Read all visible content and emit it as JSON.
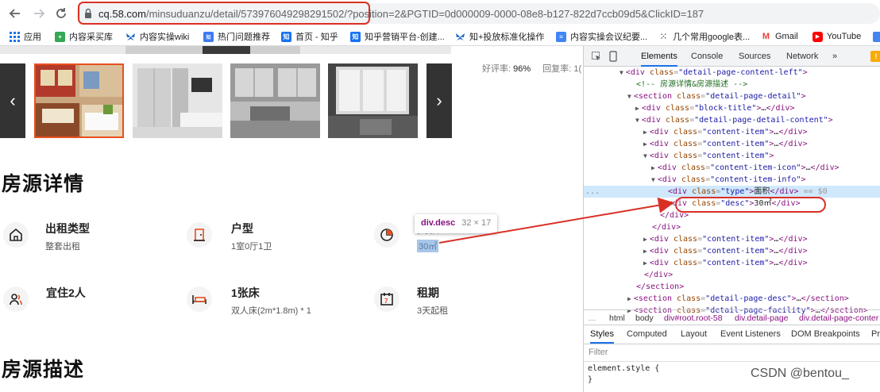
{
  "browser": {
    "url_host": "cq.58.com",
    "url_path": "/minsuduanzu/detail/57397604929829150​2/?position=2&PGTID=0d000009-0000-08e8-b127-822d7ccb09d5&ClickID=187",
    "url_path_clean": "/minsuduanzu/detail/573976049298291502/?position=2&PGTID=0d000009-0000-08e8-b127-822d7ccb09d5&ClickID=187"
  },
  "bookmarks": [
    {
      "label": "应用",
      "icon": "apps-grid-icon",
      "color": "#1a73e8"
    },
    {
      "label": "内容采买库",
      "icon": "plus-square-icon",
      "color": "#34a853"
    },
    {
      "label": "内容实操wiki",
      "icon": "butterfly-icon",
      "color": "#1565c0"
    },
    {
      "label": "热门问题推荐",
      "icon": "zhihu-bubble-icon",
      "color": "#3d7bf6"
    },
    {
      "label": "首页 - 知乎",
      "icon": "zhihu-icon",
      "color": "#1772f6"
    },
    {
      "label": "知乎营销平台-创建...",
      "icon": "zhihu-icon",
      "color": "#1772f6"
    },
    {
      "label": "知+投放标准化操作",
      "icon": "butterfly-icon",
      "color": "#1565c0"
    },
    {
      "label": "内容实操会议纪要...",
      "icon": "doc-icon",
      "color": "#4285f4"
    },
    {
      "label": "几个常用google表...",
      "icon": "dots-grid-icon",
      "color": "#5f6368"
    },
    {
      "label": "Gmail",
      "icon": "gmail-icon",
      "color": "#ea4335"
    },
    {
      "label": "YouTube",
      "icon": "youtube-icon",
      "color": "#ff0000"
    }
  ],
  "gallery": {
    "prev_label": "‹",
    "next_label": "›"
  },
  "rating": {
    "good_label": "好评率:",
    "good_value": "96%",
    "reply_label": "回复率:",
    "reply_value": "1("
  },
  "sections": {
    "detail_title": "房源详情",
    "desc_title": "房源描述"
  },
  "items": [
    {
      "type": "出租类型",
      "desc": "整套出租",
      "icon": "house-icon"
    },
    {
      "type": "户型",
      "desc": "1室0厅1卫",
      "icon": "door-icon"
    },
    {
      "type": "面积",
      "desc": "30㎡",
      "icon": "pie-icon"
    },
    {
      "type": "宜住2人",
      "desc": "",
      "icon": "people-icon"
    },
    {
      "type": "1张床",
      "desc": "双人床(2m*1.8m) * 1",
      "icon": "bed-icon"
    },
    {
      "type": "租期",
      "desc": "3天起租",
      "icon": "calendar-icon"
    }
  ],
  "tooltip": {
    "selector": "div.desc",
    "size": "32 × 17"
  },
  "devtools": {
    "tabs": [
      "Elements",
      "Console",
      "Sources",
      "Network",
      "»"
    ],
    "warn_count": "!",
    "dom_lines": [
      {
        "indent": 0,
        "tri": "▼",
        "html": "<div class=\"detail-page-content-left\">"
      },
      {
        "indent": 1,
        "tri": "",
        "comment": "<!-- 房源详情&房源描述 -->"
      },
      {
        "indent": 1,
        "tri": "▼",
        "html": "<section class=\"detail-page-detail\">"
      },
      {
        "indent": 2,
        "tri": "▶",
        "html": "<div class=\"block-title\">…</div>"
      },
      {
        "indent": 2,
        "tri": "▼",
        "html": "<div class=\"detail-page-detail-content\">"
      },
      {
        "indent": 3,
        "tri": "▶",
        "html": "<div class=\"content-item\">…</div>"
      },
      {
        "indent": 3,
        "tri": "▶",
        "html": "<div class=\"content-item\">…</div>"
      },
      {
        "indent": 3,
        "tri": "▼",
        "html": "<div class=\"content-item\">"
      },
      {
        "indent": 4,
        "tri": "▶",
        "html": "<div class=\"content-item-icon\">…</div>"
      },
      {
        "indent": 4,
        "tri": "▼",
        "html": "<div class=\"content-item-info\">"
      },
      {
        "indent": 5,
        "tri": "",
        "html": "<div class=\"type\">面积</div>",
        "suffix": " == $0",
        "selected": true
      },
      {
        "indent": 5,
        "tri": "",
        "html": "<div class=\"desc\">30㎡</div>"
      },
      {
        "indent": 4,
        "tri": "",
        "html": "</div>"
      },
      {
        "indent": 3,
        "tri": "",
        "html": "</div>"
      },
      {
        "indent": 3,
        "tri": "▶",
        "html": "<div class=\"content-item\">…</div>"
      },
      {
        "indent": 3,
        "tri": "▶",
        "html": "<div class=\"content-item\">…</div>"
      },
      {
        "indent": 3,
        "tri": "▶",
        "html": "<div class=\"content-item\">…</div>"
      },
      {
        "indent": 2,
        "tri": "",
        "html": "</div>"
      },
      {
        "indent": 1,
        "tri": "",
        "html": "</section>"
      },
      {
        "indent": 1,
        "tri": "▶",
        "html": "<section class=\"detail-page-desc\">…</section>"
      },
      {
        "indent": 1,
        "tri": "▶",
        "html": "<section class=\"detail-page-facility\">…</section>"
      }
    ],
    "breadcrumb": [
      "...",
      "html",
      "body",
      "div#root.root-58",
      "div.detail-page",
      "div.detail-page-conter"
    ],
    "style_tabs": [
      "Styles",
      "Computed",
      "Layout",
      "Event Listeners",
      "DOM Breakpoints",
      "Pr"
    ],
    "filter_placeholder": "Filter",
    "style_code": [
      "element.style {",
      "}"
    ]
  },
  "watermark": "CSDN @bentou_",
  "colors": {
    "annotation_red": "#d93025",
    "selection_blue": "#cfe8fc",
    "tag_purple": "#881280"
  }
}
